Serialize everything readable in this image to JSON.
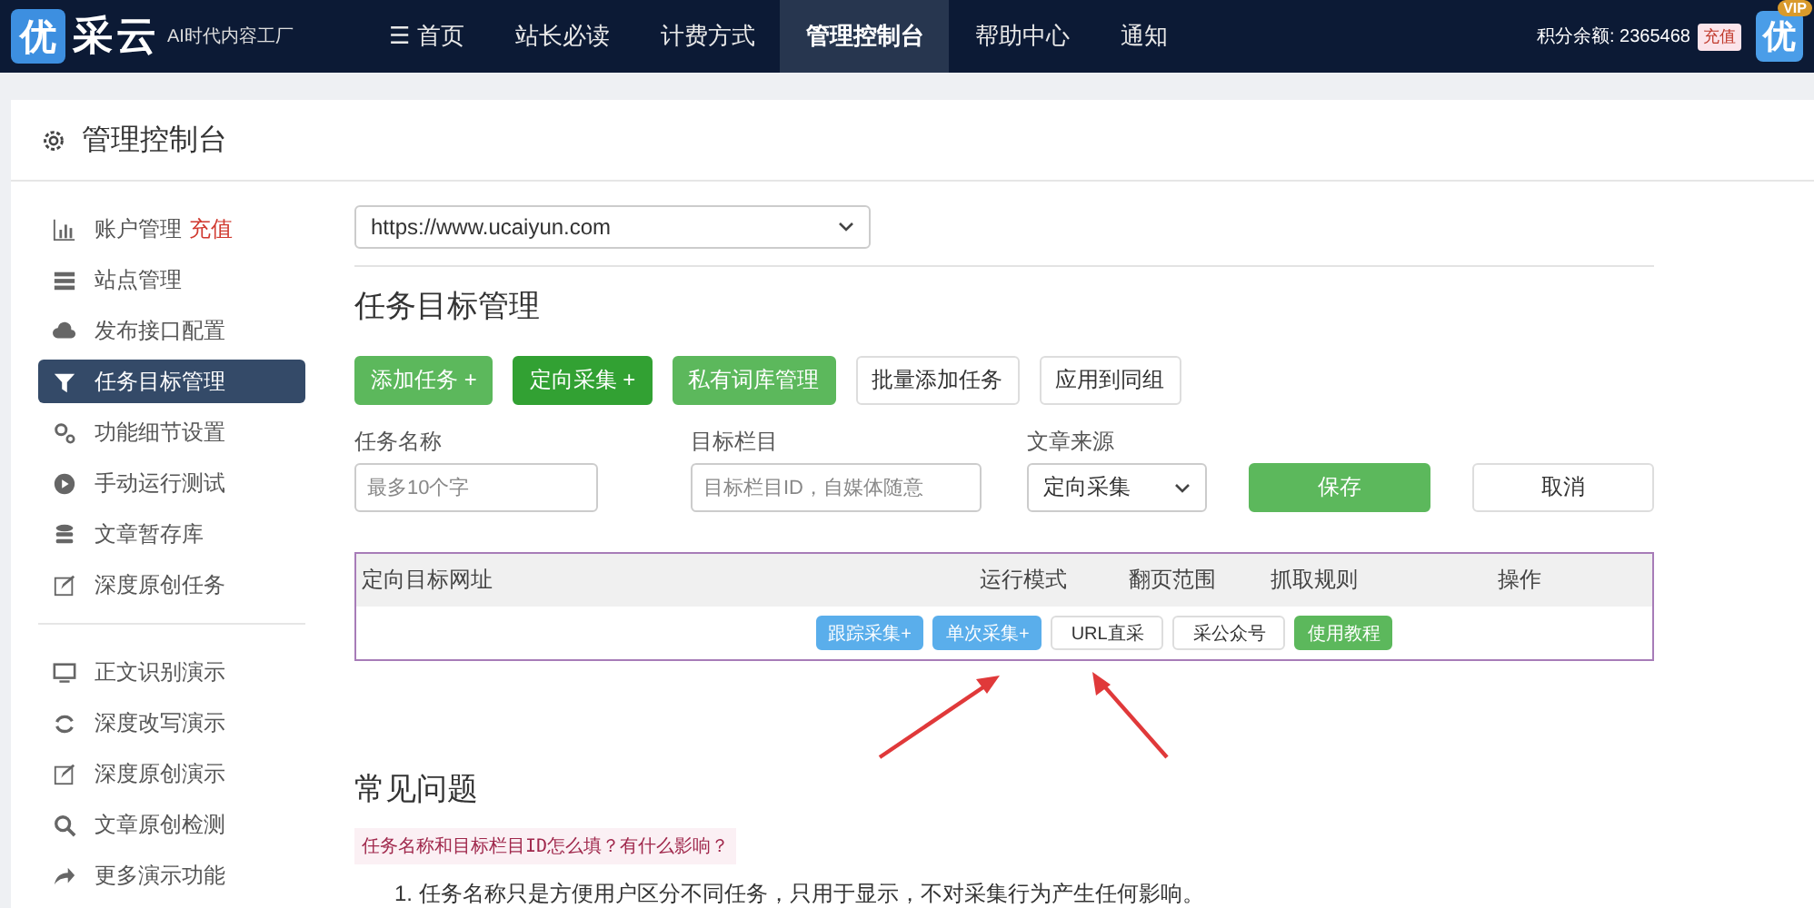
{
  "navbar": {
    "logo_mark": "优",
    "logo_text": "采云",
    "tagline": "AI时代内容工厂",
    "items": [
      {
        "label": "☰ 首页",
        "selected": false
      },
      {
        "label": "站长必读",
        "selected": false
      },
      {
        "label": "计费方式",
        "selected": false
      },
      {
        "label": "管理控制台",
        "selected": true
      },
      {
        "label": "帮助中心",
        "selected": false
      },
      {
        "label": "通知",
        "selected": false
      }
    ],
    "balance": "积分余额: 2365468",
    "recharge": "充值",
    "avatar_mark": "优",
    "avatar_badge": "VIP"
  },
  "page_title": "管理控制台",
  "sidebar": {
    "groups": [
      [
        {
          "label": "账户管理",
          "badge": "充值",
          "selected": false
        },
        {
          "label": "站点管理",
          "selected": false
        },
        {
          "label": "发布接口配置",
          "selected": false
        },
        {
          "label": "任务目标管理",
          "selected": true
        },
        {
          "label": "功能细节设置",
          "selected": false
        },
        {
          "label": "手动运行测试",
          "selected": false
        },
        {
          "label": "文章暂存库",
          "selected": false
        },
        {
          "label": "深度原创任务",
          "selected": false
        }
      ],
      [
        {
          "label": "正文识别演示",
          "selected": false
        },
        {
          "label": "深度改写演示",
          "selected": false
        },
        {
          "label": "深度原创演示",
          "selected": false
        },
        {
          "label": "文章原创检测",
          "selected": false
        },
        {
          "label": "更多演示功能",
          "selected": false
        }
      ]
    ]
  },
  "site_select": "https://www.ucaiyun.com",
  "section_title": "任务目标管理",
  "toolbar": [
    {
      "label": "添加任务 +",
      "kind": "green"
    },
    {
      "label": "定向采集 +",
      "kind": "darkgreen"
    },
    {
      "label": "私有词库管理",
      "kind": "green"
    },
    {
      "label": "批量添加任务",
      "kind": "default"
    },
    {
      "label": "应用到同组",
      "kind": "default"
    }
  ],
  "form": {
    "name": {
      "label": "任务名称",
      "placeholder": "最多10个字"
    },
    "column": {
      "label": "目标栏目",
      "placeholder": "目标栏目ID，自媒体随意"
    },
    "source": {
      "label": "文章来源",
      "value": "定向采集"
    },
    "save": "保存",
    "cancel": "取消"
  },
  "table": {
    "columns": [
      "定向目标网址",
      "运行模式",
      "翻页范围",
      "抓取规则",
      "操作"
    ],
    "actions": [
      {
        "label": "跟踪采集+",
        "kind": "blue"
      },
      {
        "label": "单次采集+",
        "kind": "blue"
      },
      {
        "label": "URL直采",
        "kind": "default"
      },
      {
        "label": "采公众号",
        "kind": "default"
      },
      {
        "label": "使用教程",
        "kind": "green"
      }
    ]
  },
  "faq": {
    "title": "常见问题",
    "question": "任务名称和目标栏目ID怎么填？有什么影响？",
    "answer": "1. 任务名称只是方便用户区分不同任务，只用于显示，不对采集行为产生任何影响。"
  }
}
